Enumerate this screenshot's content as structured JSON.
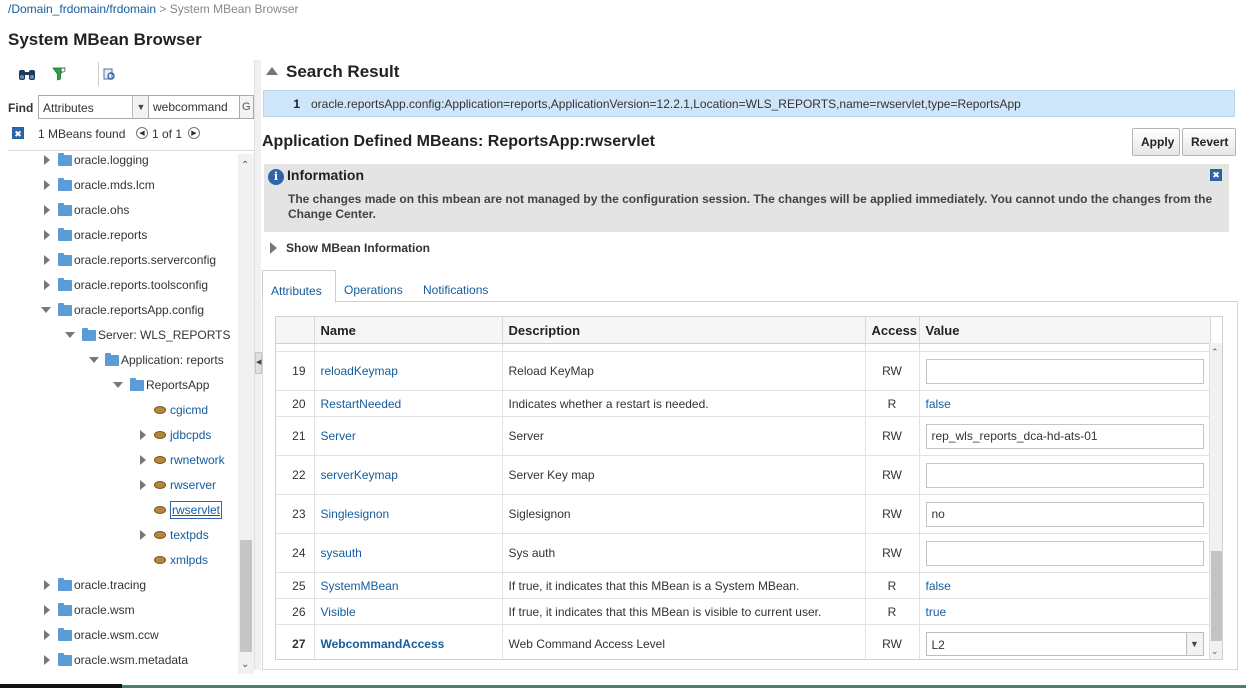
{
  "breadcrumb": {
    "link": "/Domain_frdomain/frdomain",
    "separator": ">",
    "current": "System MBean Browser"
  },
  "page_title": "System MBean Browser",
  "toolbar": {
    "icons": [
      "binoculars-icon",
      "filter-icon",
      "refresh-icon"
    ]
  },
  "find": {
    "label": "Find",
    "select_value": "Attributes",
    "input_value": "webcommand",
    "go_label": "G"
  },
  "found": {
    "text": "1 MBeans found",
    "page": "1 of 1"
  },
  "tree": {
    "items": [
      {
        "label": "oracle.logging"
      },
      {
        "label": "oracle.mds.lcm"
      },
      {
        "label": "oracle.ohs"
      },
      {
        "label": "oracle.reports"
      },
      {
        "label": "oracle.reports.serverconfig"
      },
      {
        "label": "oracle.reports.toolsconfig"
      },
      {
        "label": "oracle.reportsApp.config"
      },
      {
        "label": "Server: WLS_REPORTS"
      },
      {
        "label": "Application: reports"
      },
      {
        "label": "ReportsApp"
      },
      {
        "label": "cgicmd"
      },
      {
        "label": "jdbcpds"
      },
      {
        "label": "rwnetwork"
      },
      {
        "label": "rwserver"
      },
      {
        "label": "rwservlet"
      },
      {
        "label": "textpds"
      },
      {
        "label": "xmlpds"
      },
      {
        "label": "oracle.tracing"
      },
      {
        "label": "oracle.wsm"
      },
      {
        "label": "oracle.wsm.ccw"
      },
      {
        "label": "oracle.wsm.metadata"
      }
    ]
  },
  "search": {
    "title": "Search Result",
    "result_num": "1",
    "result_text": "oracle.reportsApp.config:Application=reports,ApplicationVersion=12.2.1,Location=WLS_REPORTS,name=rwservlet,type=ReportsApp"
  },
  "mbean": {
    "title": "Application Defined MBeans: ReportsApp:rwservlet",
    "apply_label": "Apply",
    "revert_label": "Revert"
  },
  "info": {
    "title": "Information",
    "text": "The changes made on this mbean are not managed by the configuration session. The changes will be applied immediately. You cannot undo the changes from the Change Center."
  },
  "show_mbean_info": "Show MBean Information",
  "tabs": [
    "Attributes",
    "Operations",
    "Notifications"
  ],
  "grid": {
    "headers": [
      "Name",
      "Description",
      "Access",
      "Value"
    ],
    "rows": [
      {
        "num": "19",
        "name": "reloadKeymap",
        "desc": "Reload KeyMap",
        "access": "RW",
        "value": ""
      },
      {
        "num": "20",
        "name": "RestartNeeded",
        "desc": "Indicates whether a restart is needed.",
        "access": "R",
        "value": "false"
      },
      {
        "num": "21",
        "name": "Server",
        "desc": "Server",
        "access": "RW",
        "value": "rep_wls_reports_dca-hd-ats-01"
      },
      {
        "num": "22",
        "name": "serverKeymap",
        "desc": "Server Key map",
        "access": "RW",
        "value": ""
      },
      {
        "num": "23",
        "name": "Singlesignon",
        "desc": "Siglesignon",
        "access": "RW",
        "value": "no"
      },
      {
        "num": "24",
        "name": "sysauth",
        "desc": "Sys auth",
        "access": "RW",
        "value": ""
      },
      {
        "num": "25",
        "name": "SystemMBean",
        "desc": "If true, it indicates that this MBean is a System MBean.",
        "access": "R",
        "value": "false"
      },
      {
        "num": "26",
        "name": "Visible",
        "desc": "If true, it indicates that this MBean is visible to current user.",
        "access": "R",
        "value": "true"
      },
      {
        "num": "27",
        "name": "WebcommandAccess",
        "desc": "Web Command Access Level",
        "access": "RW",
        "value": "L2"
      }
    ]
  },
  "colors": {
    "link": "#145c9e",
    "selection": "#cfe6fa",
    "info_bg": "#e4e4e4",
    "accent": "#2f64a8"
  }
}
